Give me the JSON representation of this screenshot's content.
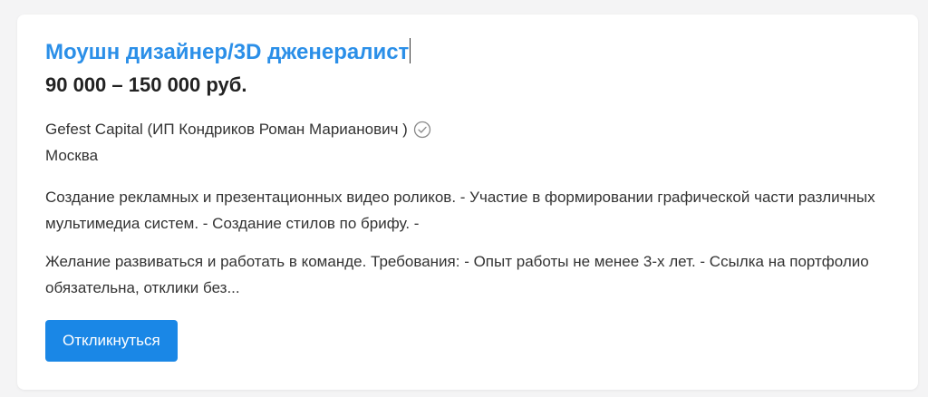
{
  "vacancy": {
    "title": "Моушн дизайнер/3D дженералист",
    "salary": "90 000 – 150 000 руб.",
    "company": "Gefest Capital (ИП Кондриков Роман Марианович )",
    "verified_icon": "check-circle-icon",
    "city": "Москва",
    "responsibilities": "Создание рекламных и презентационных видео роликов. - Участие в формировании графической части различных мультимедиа систем. - Создание стилов по брифу. -",
    "requirements": "Желание развиваться и работать в команде. Требования: - Опыт работы не менее 3-х лет. - Ссылка на портфолио обязательна, отклики без...",
    "apply_label": "Откликнуться"
  },
  "colors": {
    "title": "#2b8fe8",
    "button": "#1a87e6",
    "text": "#333333",
    "background": "#f4f4f5"
  }
}
